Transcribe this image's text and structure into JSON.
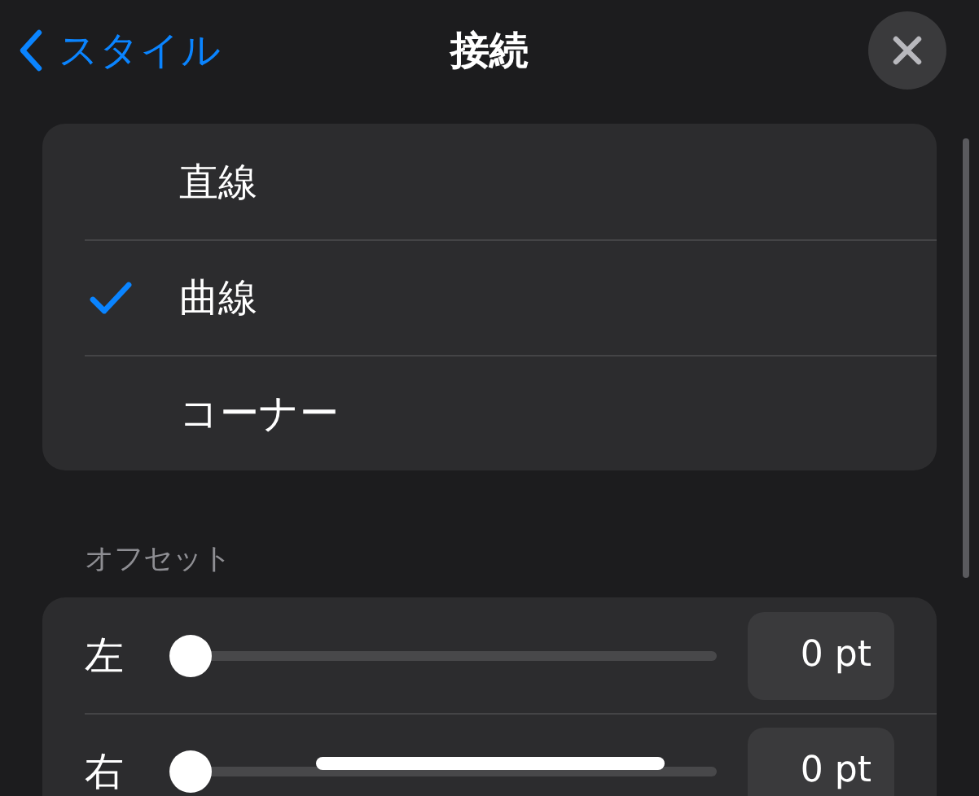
{
  "nav": {
    "back": "スタイル",
    "title": "接続"
  },
  "line_types": [
    {
      "label": "直線",
      "selected": false
    },
    {
      "label": "曲線",
      "selected": true
    },
    {
      "label": "コーナー",
      "selected": false
    }
  ],
  "offset": {
    "header": "オフセット",
    "sliders": [
      {
        "label": "左",
        "level": 0,
        "value": "0 pt"
      },
      {
        "label": "右",
        "level": 0,
        "value": "0 pt"
      }
    ]
  }
}
